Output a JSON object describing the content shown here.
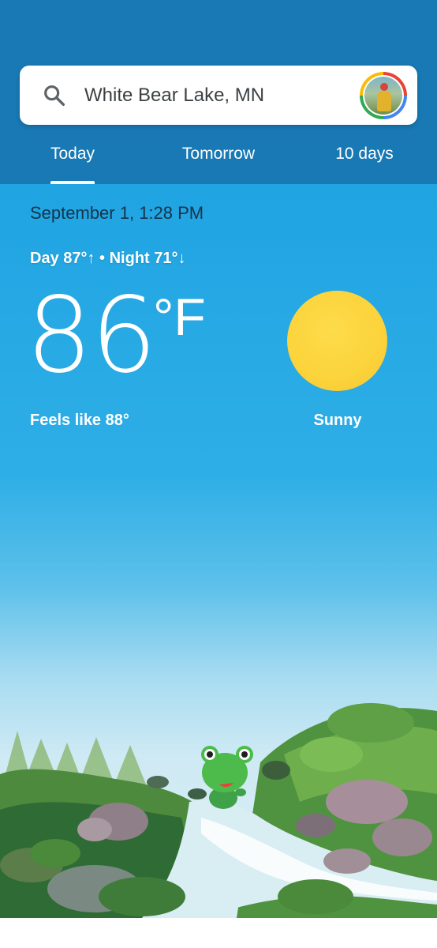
{
  "search": {
    "location": "White Bear Lake, MN"
  },
  "tabs": [
    {
      "label": "Today",
      "selected": true
    },
    {
      "label": "Tomorrow",
      "selected": false
    },
    {
      "label": "10 days",
      "selected": false
    }
  ],
  "weather": {
    "datetime": "September 1, 1:28 PM",
    "day_night": "Day 87°↑ • Night 71°↓",
    "temperature": "86",
    "unit": "°F",
    "feels_like": "Feels like 88°",
    "condition": "Sunny"
  },
  "colors": {
    "header": "#1879b4",
    "sky_top": "#1a9fe0",
    "sun": "#fcd33b"
  },
  "icons": {
    "search": "search-icon",
    "weather": "sun-icon",
    "mascot": "frog-mascot"
  }
}
